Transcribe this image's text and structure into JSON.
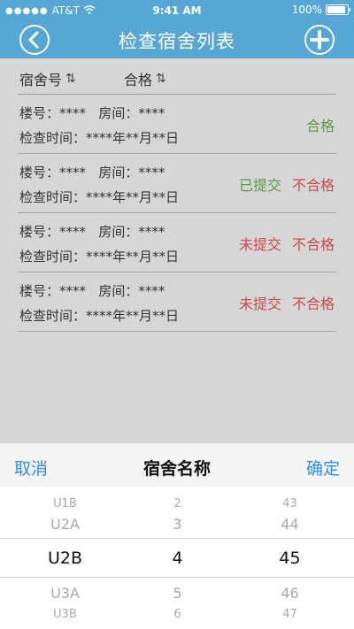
{
  "status_bar": {
    "carrier": "AT&T",
    "time": "9:41 AM",
    "battery": "100%",
    "battery_level": 1.0
  },
  "nav": {
    "title": "检查宿舍列表"
  },
  "sort_header": {
    "col1": "宿舍号",
    "col2": "合格"
  },
  "records": [
    {
      "building_label": "楼号：****",
      "room_label": "房间：****",
      "time_label": "检查时间：****年**月**日",
      "submit": "",
      "result": "合格",
      "result_color": "#5a9a3f"
    },
    {
      "building_label": "楼号：****",
      "room_label": "房间：****",
      "time_label": "检查时间：****年**月**日",
      "submit": "已提交",
      "result": "不合格",
      "submit_color": "#5a9a3f",
      "result_color": "#d04848"
    },
    {
      "building_label": "楼号：****",
      "room_label": "房间：****",
      "time_label": "检查时间：****年**月**日",
      "submit": "未提交",
      "result": "不合格",
      "submit_color": "#d04848",
      "result_color": "#d04848"
    },
    {
      "building_label": "楼号：****",
      "room_label": "房间：****",
      "time_label": "检查时间：****年**月**日",
      "submit": "未提交",
      "result": "不合格",
      "submit_color": "#d04848",
      "result_color": "#d04848"
    }
  ],
  "picker": {
    "cancel": "取消",
    "title": "宿舍名称",
    "confirm": "确定",
    "columns": [
      {
        "items": [
          "U1B",
          "U2A",
          "U2B",
          "U3A",
          "U3B"
        ],
        "selected": "U2B"
      },
      {
        "items": [
          "2",
          "3",
          "4",
          "5",
          "6"
        ],
        "selected": "4"
      },
      {
        "items": [
          "43",
          "44",
          "45",
          "46",
          "47"
        ],
        "selected": "45"
      }
    ]
  },
  "colors": {
    "header_bg": "#56a7d6",
    "link": "#2f8fe0"
  }
}
